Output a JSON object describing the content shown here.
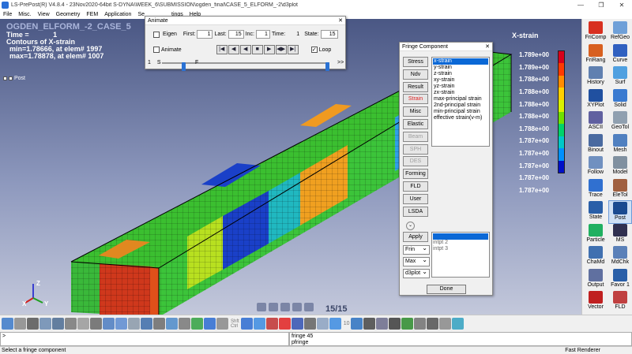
{
  "window": {
    "title": "LS-PrePost(R) V4.8.4 - 23Nov2020-64bit S-DYNA\\WEEK_6\\SUBMISSION\\ogden_final\\CASE_5_ELFORM_-2\\d3plot"
  },
  "menu": [
    "File",
    "Misc.",
    "View",
    "Geometry",
    "FEM",
    "Application",
    "Se",
    "tings",
    "Help"
  ],
  "viewport": {
    "model_title": "OGDEN_ELFORM_-2_CASE_5",
    "time_label": "Time =",
    "time_value": "1",
    "contours_label": "Contours of X-strain",
    "min_text": "min=1.78666, at elem# 1997",
    "max_text": "max=1.78878, at elem# 1007",
    "post_label": "Post",
    "frame": "15/15",
    "axes": {
      "x": "X",
      "y": "Y",
      "z": "Z"
    }
  },
  "legend": {
    "title": "X-strain",
    "labels": [
      "1.789e+00",
      "1.789e+00",
      "1.788e+00",
      "1.788e+00",
      "1.788e+00",
      "1.788e+00",
      "1.788e+00",
      "1.787e+00",
      "1.787e+00",
      "1.787e+00",
      "1.787e+00",
      "1.787e+00"
    ],
    "colors": [
      "#d8001a",
      "#ff3a00",
      "#ff8c00",
      "#ffd000",
      "#d8f000",
      "#6fe000",
      "#00d36a",
      "#00c8c8",
      "#0090ff",
      "#0010c8"
    ]
  },
  "animate": {
    "title": "Animate",
    "eigen_label": "Eigen",
    "first_label": "First:",
    "first_value": "1",
    "last_label": "Last:",
    "last_value": "15",
    "inc_label": "Inc:",
    "inc_value": "1",
    "time_label": "Time:",
    "time_value": "1",
    "state_label": "State:",
    "state_value": "15",
    "animate_label": "Animate",
    "loop_label": "Loop",
    "loop_check": "✓",
    "slider_start": "1",
    "slow_label": "S",
    "fast_label": "F",
    "more_label": ">>",
    "speed_level": 0.12,
    "state_level": 1.0
  },
  "fringe": {
    "title": "Fringe Component",
    "buttons": [
      "Stress",
      "Ndv",
      "Result",
      "Strain",
      "Misc",
      "Elastic",
      "Beam",
      "SPH",
      "DES",
      "Forming",
      "FLD",
      "User",
      "LSDA"
    ],
    "selected_button": "Strain",
    "components": [
      "x-strain",
      "y-strain",
      "z-strain",
      "xy-strain",
      "yz-strain",
      "zx-strain",
      "max-principal strain",
      "2nd-principal strain",
      "min-principal strain",
      "effective strain(v-m)"
    ],
    "selected_component": "x-strain",
    "apply_label": "Apply",
    "dropdowns": [
      "Frin",
      "Max",
      "d3plot"
    ],
    "ipt_list": [
      "intpt   2",
      "intpt   3"
    ],
    "done_label": "Done"
  },
  "right_panel": [
    {
      "label": "FriComp",
      "color": "#d83020",
      "active": false
    },
    {
      "label": "RefGeo",
      "color": "#6fa0d8",
      "active": false
    },
    {
      "label": "FriRang",
      "color": "#d86020",
      "active": false
    },
    {
      "label": "Curve",
      "color": "#3060c0",
      "active": false
    },
    {
      "label": "History",
      "color": "#6080b0",
      "active": false
    },
    {
      "label": "Surf",
      "color": "#50a0e0",
      "active": false
    },
    {
      "label": "XYPlot",
      "color": "#2050a0",
      "active": false
    },
    {
      "label": "Solid",
      "color": "#3a7ad0",
      "active": false
    },
    {
      "label": "ASCII",
      "color": "#6060a0",
      "active": false
    },
    {
      "label": "GeoTol",
      "color": "#90a0b0",
      "active": false
    },
    {
      "label": "Binout",
      "color": "#4a6aa0",
      "active": false
    },
    {
      "label": "Mesh",
      "color": "#5080c0",
      "active": false
    },
    {
      "label": "Follow",
      "color": "#7090c0",
      "active": false
    },
    {
      "label": "Model",
      "color": "#8090a0",
      "active": false
    },
    {
      "label": "Trace",
      "color": "#3070d0",
      "active": false
    },
    {
      "label": "EleTol",
      "color": "#a06040",
      "active": false
    },
    {
      "label": "State",
      "color": "#2a5fa8",
      "active": false
    },
    {
      "label": "Post",
      "color": "#1a4a90",
      "active": true
    },
    {
      "label": "Particle",
      "color": "#20b060",
      "active": false
    },
    {
      "label": "MS",
      "color": "#303050",
      "active": false
    },
    {
      "label": "ChaMd",
      "color": "#4070b0",
      "active": false
    },
    {
      "label": "MdChk",
      "color": "#5a80b8",
      "active": false
    },
    {
      "label": "Output",
      "color": "#6070a0",
      "active": false
    },
    {
      "label": "Favor 1",
      "color": "#2a5fa8",
      "active": false
    },
    {
      "label": "Vector",
      "color": "#c02020",
      "active": false
    },
    {
      "label": "FLD",
      "color": "#c04040",
      "active": false
    }
  ],
  "toolbar": {
    "label_shift": "Shft",
    "label_ctrl": "Ctrl",
    "count": "10"
  },
  "command": {
    "prompt": ">",
    "history": [
      "fringe 45",
      "pfringe"
    ]
  },
  "status": {
    "message": "Select a fringe component",
    "renderer": "Fast Renderer"
  }
}
